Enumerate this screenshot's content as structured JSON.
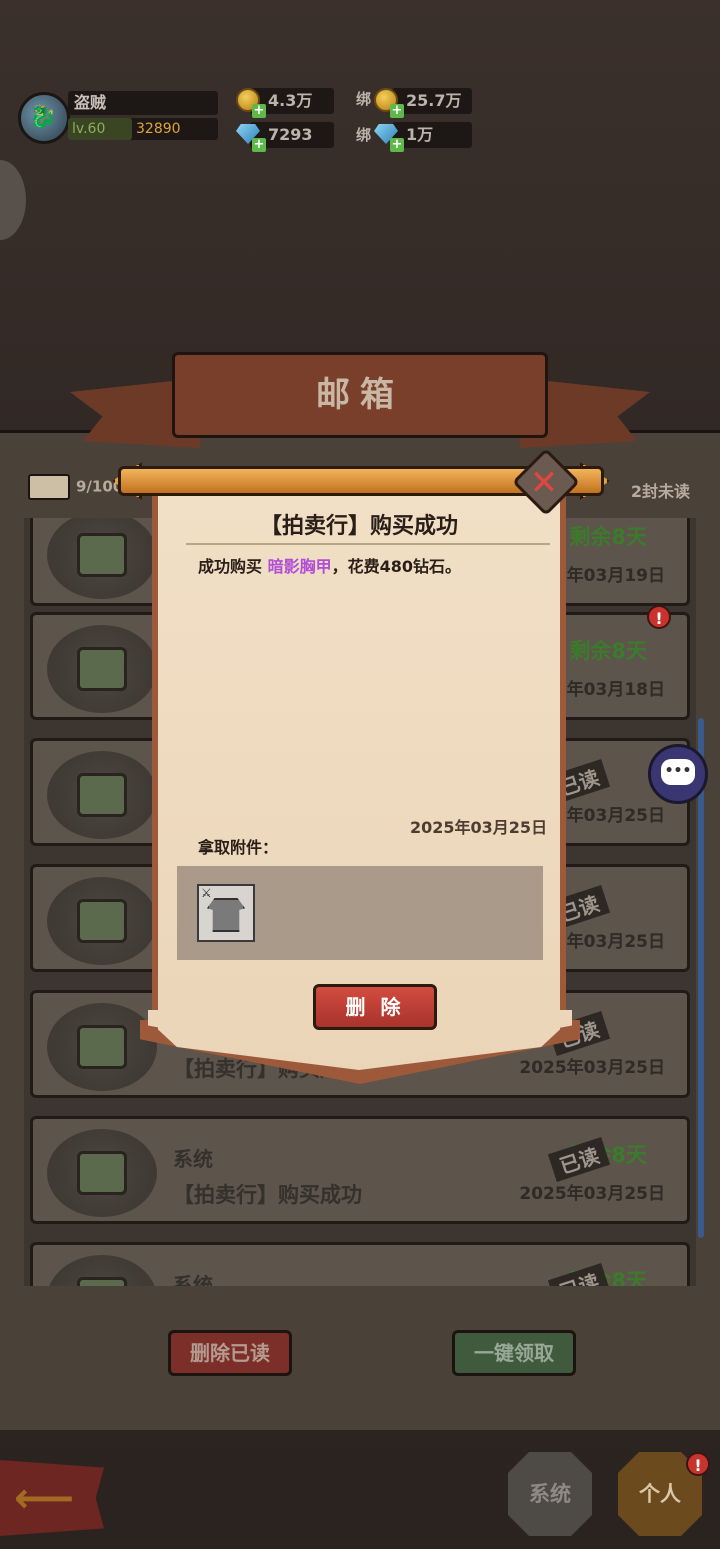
{
  "player": {
    "name": "盗贼",
    "level": "lv.60",
    "power": "32890"
  },
  "resources": {
    "gold": "4.3万",
    "diamond": "7293",
    "bound_label": "绑",
    "bound_gold": "25.7万",
    "bound_diamond": "1万"
  },
  "mailbox": {
    "title": "邮箱",
    "mail_count": "9/100",
    "unread_count": "2封未读"
  },
  "mail_list": [
    {
      "sender": "",
      "subject": "",
      "remaining": "剩余8天",
      "date": "2025年03月19日",
      "read": ""
    },
    {
      "sender": "",
      "subject": "",
      "remaining": "剩余8天",
      "date": "2025年03月18日",
      "read": ""
    },
    {
      "sender": "",
      "subject": "",
      "remaining": "剩余8天",
      "date": "2025年03月25日",
      "read": "已读"
    },
    {
      "sender": "",
      "subject": "",
      "remaining": "剩余8天",
      "date": "2025年03月25日",
      "read": "已读"
    },
    {
      "sender": "",
      "subject": "【拍卖行】购买成功",
      "remaining": "剩余8天",
      "date": "2025年03月25日",
      "read": "已读"
    },
    {
      "sender": "系统",
      "subject": "【拍卖行】购买成功",
      "remaining": "剩余8天",
      "date": "2025年03月25日",
      "read": "已读"
    },
    {
      "sender": "系统",
      "subject": "",
      "remaining": "剩余8天",
      "date": "",
      "read": "已读"
    }
  ],
  "bottom_actions": {
    "delete_read": "删除已读",
    "claim_all": "一键领取"
  },
  "tabs": {
    "system": "系统",
    "personal": "个人",
    "personal_badge": "!"
  },
  "mail_detail": {
    "title": "【拍卖行】购买成功",
    "body_prefix": "成功购买",
    "item_name": "暗影胸甲",
    "body_suffix": "，花费480钻石。",
    "date": "2025年03月25日",
    "attachment_label": "拿取附件：",
    "delete_button": "删 除",
    "close_icon": "close-icon"
  },
  "colors": {
    "item_highlight": "#b04fd6",
    "remaining_green": "#3c7a2c",
    "delete_red": "#c8412f"
  }
}
